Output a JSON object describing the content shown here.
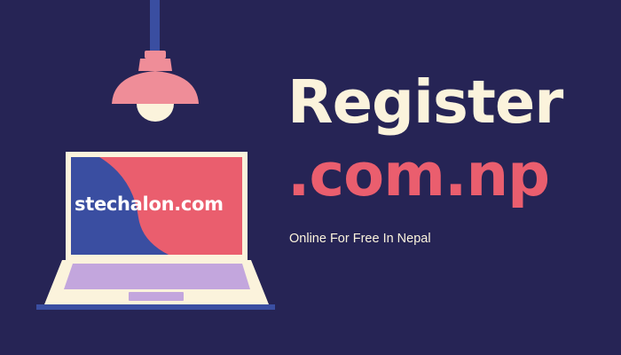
{
  "banner": {
    "site_label": "stechalon.com",
    "headline_line1": "Register",
    "headline_line2": ".com.np",
    "tagline": "Online For Free In Nepal"
  },
  "colors": {
    "background": "#262455",
    "cream": "#fbf3dc",
    "coral": "#ea5e6e",
    "blue": "#3a4ea1",
    "lamp_pink": "#ef8d98",
    "keyboard_lavender": "#c3a6dd"
  },
  "icons": [
    "pendant-lamp-icon",
    "laptop-icon"
  ]
}
